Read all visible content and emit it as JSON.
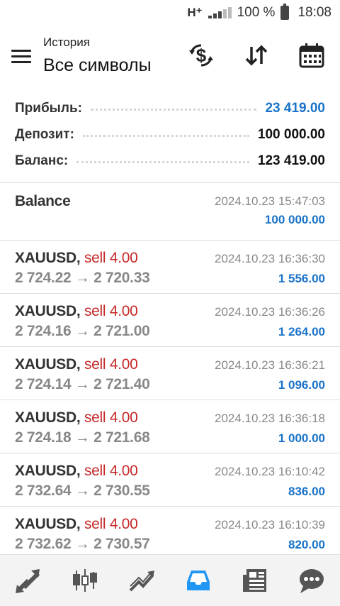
{
  "status_bar": {
    "network": "H⁺",
    "battery_text": "100 %",
    "time": "18:08"
  },
  "header": {
    "subtitle": "История",
    "title": "Все символы",
    "icons": [
      "menu-icon",
      "currency-exchange-icon",
      "sort-arrows-icon",
      "calendar-icon"
    ]
  },
  "summary": {
    "profit_label": "Прибыль:",
    "profit_value": "23 419.00",
    "deposit_label": "Депозит:",
    "deposit_value": "100 000.00",
    "balance_label": "Баланс:",
    "balance_value": "123 419.00"
  },
  "balance_entry": {
    "label": "Balance",
    "time": "2024.10.23 15:47:03",
    "amount": "100 000.00"
  },
  "deals": [
    {
      "symbol": "XAUUSD,",
      "side": "sell 4.00",
      "prices": "2 724.22 → 2 720.33",
      "time": "2024.10.23 16:36:30",
      "profit": "1 556.00"
    },
    {
      "symbol": "XAUUSD,",
      "side": "sell 4.00",
      "prices": "2 724.16 → 2 721.00",
      "time": "2024.10.23 16:36:26",
      "profit": "1 264.00"
    },
    {
      "symbol": "XAUUSD,",
      "side": "sell 4.00",
      "prices": "2 724.14 → 2 721.40",
      "time": "2024.10.23 16:36:21",
      "profit": "1 096.00"
    },
    {
      "symbol": "XAUUSD,",
      "side": "sell 4.00",
      "prices": "2 724.18 → 2 721.68",
      "time": "2024.10.23 16:36:18",
      "profit": "1 000.00"
    },
    {
      "symbol": "XAUUSD,",
      "side": "sell 4.00",
      "prices": "2 732.64 → 2 730.55",
      "time": "2024.10.23 16:10:42",
      "profit": "836.00"
    },
    {
      "symbol": "XAUUSD,",
      "side": "sell 4.00",
      "prices": "2 732.62 → 2 730.57",
      "time": "2024.10.23 16:10:39",
      "profit": "820.00"
    }
  ],
  "bottom_nav": {
    "items": [
      "trade-arrows-icon",
      "candlestick-icon",
      "chart-trend-icon",
      "history-inbox-icon",
      "news-icon",
      "chat-icon"
    ],
    "active": "history-inbox-icon",
    "active_color": "#2196f3"
  }
}
